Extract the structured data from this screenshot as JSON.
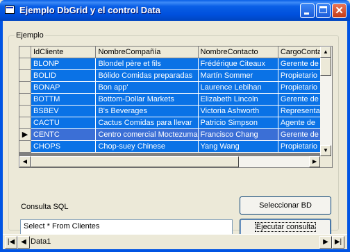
{
  "window": {
    "title": "Ejemplo DbGrid y el control Data"
  },
  "frame": {
    "legend": "Ejemplo"
  },
  "grid": {
    "columns": [
      "IdCliente",
      "NombreCompañía",
      "NombreContacto",
      "CargoConta"
    ],
    "rows": [
      [
        "BLONP",
        "Blondel père et fils",
        "Frédérique Citeaux",
        "Gerente de"
      ],
      [
        "BOLID",
        "Bólido Comidas preparadas",
        "Martín Sommer",
        "Propietario"
      ],
      [
        "BONAP",
        "Bon app'",
        "Laurence Lebihan",
        "Propietario"
      ],
      [
        "BOTTM",
        "Bottom-Dollar Markets",
        "Elizabeth Lincoln",
        "Gerente de"
      ],
      [
        "BSBEV",
        "B's Beverages",
        "Victoria Ashworth",
        "Representa"
      ],
      [
        "CACTU",
        "Cactus Comidas para llevar",
        "Patricio Simpson",
        "Agente de"
      ],
      [
        "CENTC",
        "Centro comercial Moctezuma",
        "Francisco Chang",
        "Gerente de"
      ],
      [
        "CHOPS",
        "Chop-suey Chinese",
        "Yang Wang",
        "Propietario"
      ]
    ],
    "current_row_index": 6,
    "current_row_marker": "▶"
  },
  "query": {
    "label": "Consulta SQL",
    "value": "Select * From Clientes",
    "select_db_button": "Seleccionar BD",
    "execute_button": "Ejecutar consulta"
  },
  "data_control": {
    "caption": "Data1",
    "first_glyph": "|◀",
    "prev_glyph": "◀",
    "next_glyph": "▶",
    "last_glyph": "▶|"
  },
  "titlebar_buttons": {
    "close_glyph": "✕"
  },
  "colors": {
    "selection": "#0a72e6",
    "titlebar": "#0054e3",
    "face": "#ece9d8"
  }
}
